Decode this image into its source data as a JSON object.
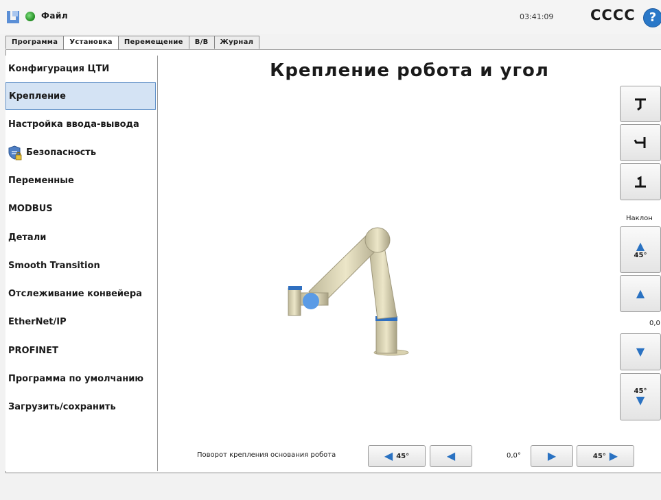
{
  "header": {
    "file_menu": "Файл",
    "clock": "03:41:09",
    "robot_name": "CCCC",
    "help": "?"
  },
  "tabs": [
    "Программа",
    "Установка",
    "Перемещение",
    "В/В",
    "Журнал"
  ],
  "sidebar": {
    "items": [
      {
        "label": "Конфигурация ЦТИ"
      },
      {
        "label": "Крепление"
      },
      {
        "label": "Настройка ввода-вывода"
      },
      {
        "label": "Безопасность",
        "icon": "shield-lock-icon"
      },
      {
        "label": "Переменные"
      },
      {
        "label": "MODBUS"
      },
      {
        "label": "Детали"
      },
      {
        "label": "Smooth Transition"
      },
      {
        "label": "Отслеживание конвейера"
      },
      {
        "label": "EtherNet/IP"
      },
      {
        "label": "PROFINET"
      },
      {
        "label": "Программа по умолчанию"
      },
      {
        "label": "Загрузить/сохранить"
      }
    ],
    "selected": "Крепление"
  },
  "main": {
    "title": "Крепление робота и угол",
    "tilt": {
      "label": "Наклон",
      "up_45": "45°",
      "down_45": "45°",
      "value": "0,0"
    },
    "rotation": {
      "label": "Поворот крепления основания робота",
      "left_45": "45°",
      "right_45": "45°",
      "value": "0,0°"
    }
  },
  "colors": {
    "accent": "#2a72c2",
    "selected_bg": "#d4e3f4",
    "status_ok": "#2fb02f"
  }
}
